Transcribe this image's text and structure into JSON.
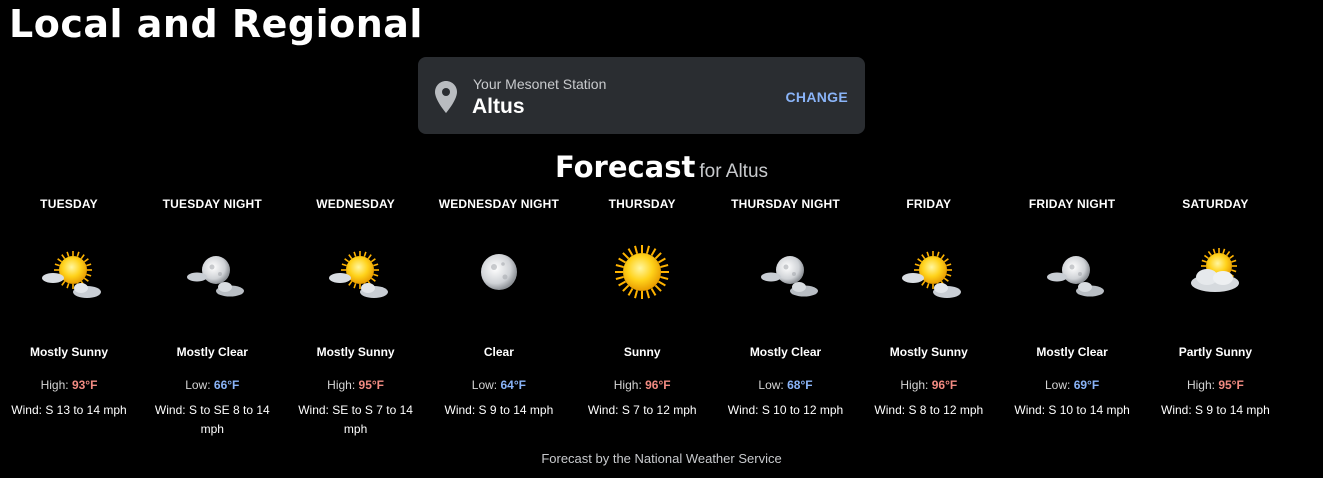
{
  "page": {
    "title": "Local and Regional"
  },
  "station": {
    "caption": "Your Mesonet Station",
    "name": "Altus",
    "change_label": "CHANGE",
    "icon": "map-pin-icon"
  },
  "forecast": {
    "heading": "Forecast",
    "for_text": "for Altus",
    "periods": [
      {
        "name": "TUESDAY",
        "icon": "mostly-sunny-icon",
        "condition": "Mostly Sunny",
        "temp_label": "High:",
        "temp": "93°F",
        "type": "high",
        "wind_label": "Wind:",
        "wind": "S 13 to 14 mph"
      },
      {
        "name": "TUESDAY NIGHT",
        "icon": "mostly-clear-night-icon",
        "condition": "Mostly Clear",
        "temp_label": "Low:",
        "temp": "66°F",
        "type": "low",
        "wind_label": "Wind:",
        "wind": "S to SE 8 to 14 mph"
      },
      {
        "name": "WEDNESDAY",
        "icon": "mostly-sunny-icon",
        "condition": "Mostly Sunny",
        "temp_label": "High:",
        "temp": "95°F",
        "type": "high",
        "wind_label": "Wind:",
        "wind": "SE to S 7 to 14 mph"
      },
      {
        "name": "WEDNESDAY NIGHT",
        "icon": "clear-night-icon",
        "condition": "Clear",
        "temp_label": "Low:",
        "temp": "64°F",
        "type": "low",
        "wind_label": "Wind:",
        "wind": "S 9 to 14 mph"
      },
      {
        "name": "THURSDAY",
        "icon": "sunny-icon",
        "condition": "Sunny",
        "temp_label": "High:",
        "temp": "96°F",
        "type": "high",
        "wind_label": "Wind:",
        "wind": "S 7 to 12 mph"
      },
      {
        "name": "THURSDAY NIGHT",
        "icon": "mostly-clear-night-icon",
        "condition": "Mostly Clear",
        "temp_label": "Low:",
        "temp": "68°F",
        "type": "low",
        "wind_label": "Wind:",
        "wind": "S 10 to 12 mph"
      },
      {
        "name": "FRIDAY",
        "icon": "mostly-sunny-icon",
        "condition": "Mostly Sunny",
        "temp_label": "High:",
        "temp": "96°F",
        "type": "high",
        "wind_label": "Wind:",
        "wind": "S 8 to 12 mph"
      },
      {
        "name": "FRIDAY NIGHT",
        "icon": "mostly-clear-night-icon",
        "condition": "Mostly Clear",
        "temp_label": "Low:",
        "temp": "69°F",
        "type": "low",
        "wind_label": "Wind:",
        "wind": "S 10 to 14 mph"
      },
      {
        "name": "SATURDAY",
        "icon": "partly-sunny-icon",
        "condition": "Partly Sunny",
        "temp_label": "High:",
        "temp": "95°F",
        "type": "high",
        "wind_label": "Wind:",
        "wind": "S 9 to 14 mph"
      }
    ],
    "footer": "Forecast by the National Weather Service"
  },
  "colors": {
    "background": "#000000",
    "card": "#2a2d31",
    "accent": "#8ab4f8",
    "high": "#f28b82",
    "low": "#8ab4f8"
  }
}
